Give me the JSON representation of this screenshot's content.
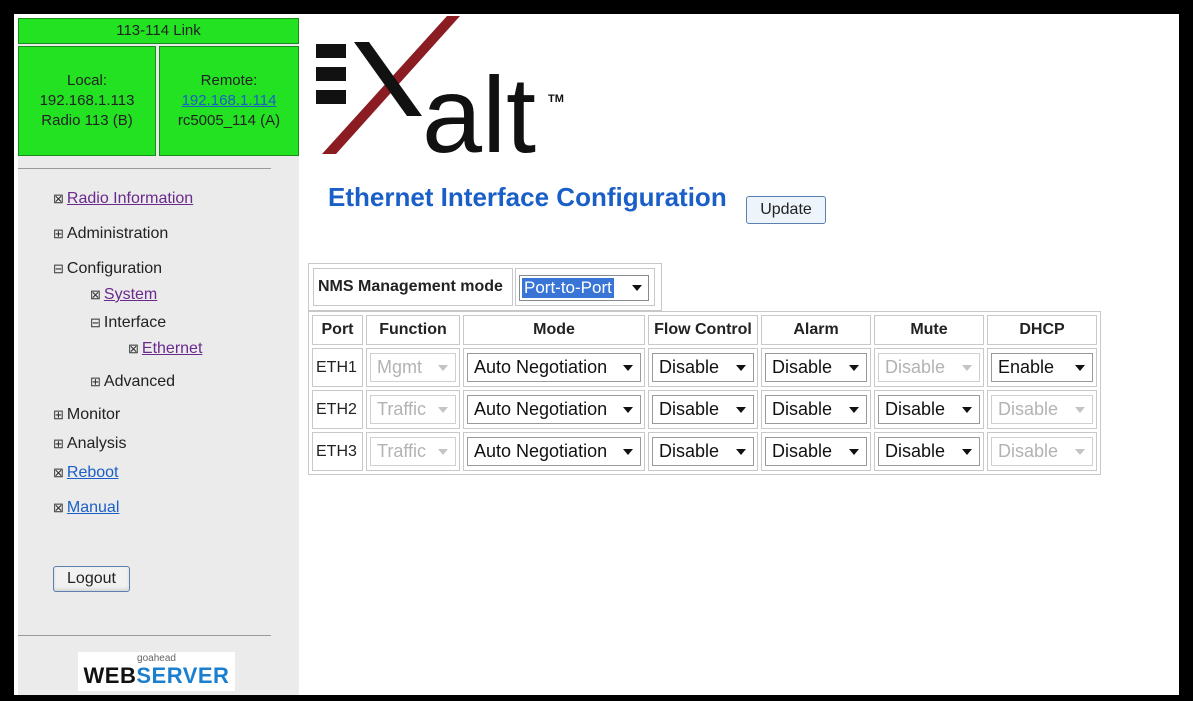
{
  "sidebar": {
    "link_title": "113-114 Link",
    "local": {
      "label": "Local:",
      "ip": "192.168.1.113",
      "radio": "Radio 113 (B)"
    },
    "remote": {
      "label": "Remote:",
      "ip": "192.168.1.114",
      "radio": "rc5005_114 (A)"
    },
    "nav": {
      "radio_information": "Radio Information",
      "administration": "Administration",
      "configuration": "Configuration",
      "system": "System",
      "interface": "Interface",
      "ethernet": "Ethernet",
      "advanced": "Advanced",
      "monitor": "Monitor",
      "analysis": "Analysis",
      "reboot": "Reboot",
      "manual": "Manual"
    },
    "glyphs": {
      "leaf": "⊠",
      "collapsed": "⊞",
      "expanded": "⊟"
    },
    "logout_label": "Logout",
    "webserver": {
      "small": "goahead",
      "web": "WEB",
      "server": "SERVER"
    }
  },
  "brand": {
    "letters": "alt",
    "tm": "TM",
    "bar_color": "#111111",
    "slash_color": "#8a1c22"
  },
  "page_title": "Ethernet Interface Configuration",
  "update_label": "Update",
  "nms": {
    "label": "NMS Management mode",
    "value": "Port-to-Port"
  },
  "table": {
    "headers": [
      "Port",
      "Function",
      "Mode",
      "Flow Control",
      "Alarm",
      "Mute",
      "DHCP"
    ],
    "rows": [
      {
        "port": "ETH1",
        "function": "Mgmt",
        "mode": "Auto Negotiation",
        "flow": "Disable",
        "alarm": "Disable",
        "mute": "Disable",
        "dhcp": "Enable",
        "mute_disabled": true,
        "dhcp_disabled": false
      },
      {
        "port": "ETH2",
        "function": "Traffic",
        "mode": "Auto Negotiation",
        "flow": "Disable",
        "alarm": "Disable",
        "mute": "Disable",
        "dhcp": "Disable",
        "mute_disabled": false,
        "dhcp_disabled": true
      },
      {
        "port": "ETH3",
        "function": "Traffic",
        "mode": "Auto Negotiation",
        "flow": "Disable",
        "alarm": "Disable",
        "mute": "Disable",
        "dhcp": "Disable",
        "mute_disabled": false,
        "dhcp_disabled": true
      }
    ]
  },
  "colors": {
    "header_green": "#22e222",
    "title_blue": "#1a5fc7",
    "visited_link": "#6a2a8c",
    "selection_blue": "#3875d7"
  }
}
